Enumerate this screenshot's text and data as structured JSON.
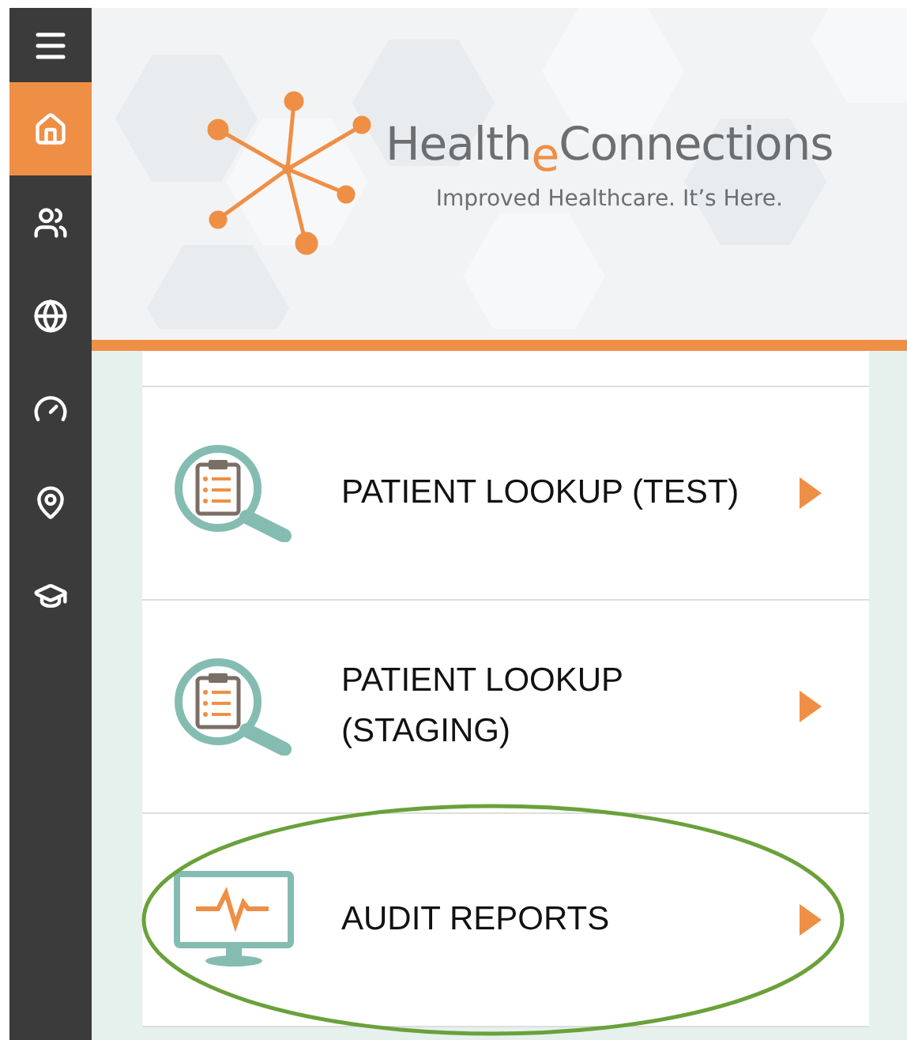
{
  "sidebar": {
    "items": [
      {
        "kind": "menu",
        "selected": false
      },
      {
        "kind": "home",
        "selected": true
      },
      {
        "kind": "users",
        "selected": false
      },
      {
        "kind": "globe",
        "selected": false
      },
      {
        "kind": "gauge",
        "selected": false
      },
      {
        "kind": "pin",
        "selected": false
      },
      {
        "kind": "cap",
        "selected": false
      }
    ]
  },
  "header": {
    "brand": "Health$_{e}$Connections",
    "tagline": "Improved Healthcare. It’s Here."
  },
  "menu": {
    "items": [
      {
        "kind": "lookup",
        "label": "PATIENT LOOKUP (TEST)",
        "highlighted": false
      },
      {
        "kind": "lookup",
        "label": "PATIENT LOOKUP (STAGING)",
        "highlighted": false
      },
      {
        "kind": "monitor",
        "label": "AUDIT REPORTS",
        "highlighted": true
      }
    ]
  }
}
